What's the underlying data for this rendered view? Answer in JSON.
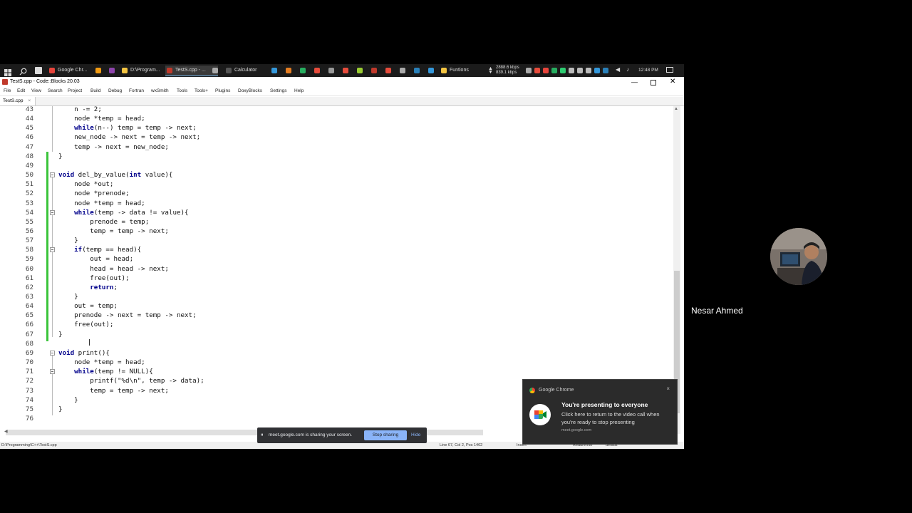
{
  "taskbar": {
    "apps": [
      {
        "label": "Google Chr...",
        "color": "#e8453c",
        "active": false
      },
      {
        "label": "D:\\Program...",
        "color": "#f4c542",
        "active": false
      },
      {
        "label": "TestS.cpp - ...",
        "color": "#c0392b",
        "active": true
      },
      {
        "label": "Calculator",
        "color": "#555555",
        "active": false
      },
      {
        "label": "Funtions",
        "color": "#f4c542",
        "active": false
      }
    ],
    "net_up": "2888.6 kbps",
    "net_down": "839.1 kbps",
    "clock": "12:48 PM"
  },
  "window": {
    "title": "TestS.cpp - Code::Blocks 20.03"
  },
  "menu": [
    "File",
    "Edit",
    "View",
    "Search",
    "Project",
    "Build",
    "Debug",
    "Fortran",
    "wxSmith",
    "Tools",
    "Tools+",
    "Plugins",
    "DoxyBlocks",
    "Settings",
    "Help"
  ],
  "tab": {
    "label": "TestS.cpp",
    "close": "×"
  },
  "code_lines": [
    {
      "num": "43",
      "text": "    n -= 2;"
    },
    {
      "num": "44",
      "text": "    node *temp = head;"
    },
    {
      "num": "45",
      "text": "    while(n--) temp = temp -> next;"
    },
    {
      "num": "46",
      "text": "    new_node -> next = temp -> next;"
    },
    {
      "num": "47",
      "text": "    temp -> next = new_node;"
    },
    {
      "num": "48",
      "text": "}"
    },
    {
      "num": "49",
      "text": ""
    },
    {
      "num": "50",
      "text": "void del_by_value(int value){"
    },
    {
      "num": "51",
      "text": "    node *out;"
    },
    {
      "num": "52",
      "text": "    node *prenode;"
    },
    {
      "num": "53",
      "text": "    node *temp = head;"
    },
    {
      "num": "54",
      "text": "    while(temp -> data != value){"
    },
    {
      "num": "55",
      "text": "        prenode = temp;"
    },
    {
      "num": "56",
      "text": "        temp = temp -> next;"
    },
    {
      "num": "57",
      "text": "    }"
    },
    {
      "num": "58",
      "text": "    if(temp == head){"
    },
    {
      "num": "59",
      "text": "        out = head;"
    },
    {
      "num": "60",
      "text": "        head = head -> next;"
    },
    {
      "num": "61",
      "text": "        free(out);"
    },
    {
      "num": "62",
      "text": "        return;"
    },
    {
      "num": "63",
      "text": "    }"
    },
    {
      "num": "64",
      "text": "    out = temp;"
    },
    {
      "num": "65",
      "text": "    prenode -> next = temp -> next;"
    },
    {
      "num": "66",
      "text": "    free(out);"
    },
    {
      "num": "67",
      "text": "}"
    },
    {
      "num": "68",
      "text": ""
    },
    {
      "num": "69",
      "text": "void print(){"
    },
    {
      "num": "70",
      "text": "    node *temp = head;"
    },
    {
      "num": "71",
      "text": "    while(temp != NULL){"
    },
    {
      "num": "72",
      "text": "        printf(\"%d\\n\", temp -> data);"
    },
    {
      "num": "73",
      "text": "        temp = temp -> next;"
    },
    {
      "num": "74",
      "text": "    }"
    },
    {
      "num": "75",
      "text": "}"
    },
    {
      "num": "76",
      "text": ""
    }
  ],
  "statusbar": {
    "path": "D:\\Programming\\C++\\TestS.cpp",
    "position": "Line 67, Col 2, Pos 1462",
    "mode": "Insert",
    "access": "Read/Write",
    "profile": "default"
  },
  "share_bar": {
    "message": "meet.google.com is sharing your screen.",
    "stop": "Stop sharing",
    "hide": "Hide"
  },
  "toast": {
    "app": "Google Chrome",
    "close": "×",
    "title": "You're presenting to everyone",
    "body": "Click here to return to the video call when you're ready to stop presenting",
    "source": "meet.google.com"
  },
  "participant": {
    "name": "Nesar Ahmed"
  }
}
